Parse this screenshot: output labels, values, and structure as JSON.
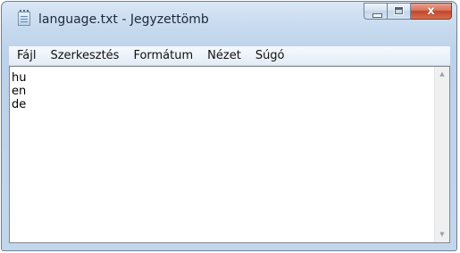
{
  "window": {
    "title": "language.txt - Jegyzettömb"
  },
  "caption_buttons": {
    "close_glyph": "x"
  },
  "menu": {
    "items": [
      "Fájl",
      "Szerkesztés",
      "Formátum",
      "Nézet",
      "Súgó"
    ]
  },
  "editor": {
    "lines": [
      "hu",
      "en",
      "de"
    ]
  },
  "scrollbar": {
    "up_arrow": "▲",
    "down_arrow": "▼"
  }
}
